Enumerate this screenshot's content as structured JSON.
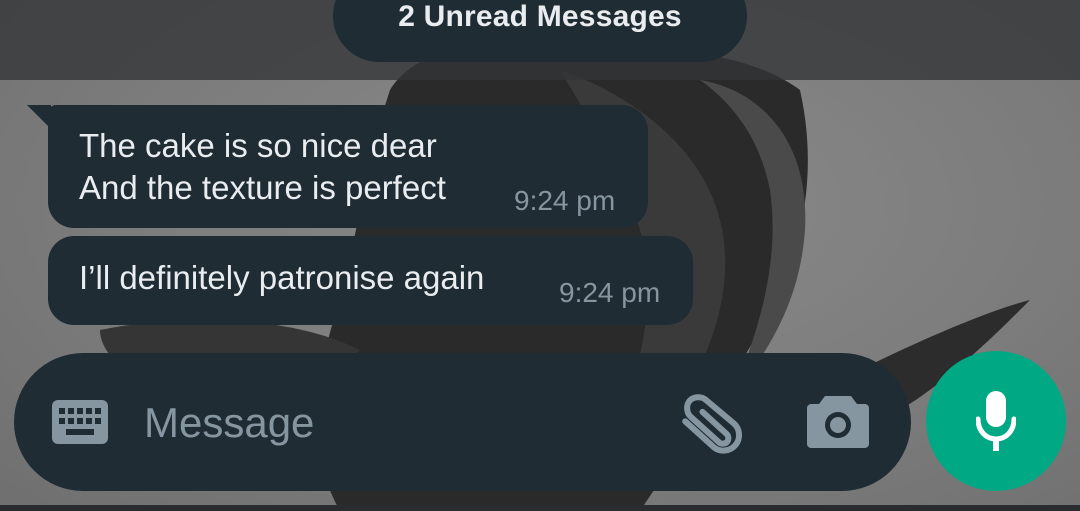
{
  "banner": {
    "unread_text": "2 Unread Messages"
  },
  "messages": [
    {
      "lines": "The cake is so nice dear\nAnd the texture is perfect",
      "time": "9:24 pm"
    },
    {
      "lines": "I’ll definitely patronise again",
      "time": "9:24 pm"
    }
  ],
  "composer": {
    "placeholder": "Message",
    "value": "",
    "icons": {
      "keyboard": "keyboard-icon",
      "attach": "paperclip-icon",
      "camera": "camera-icon",
      "mic": "microphone-icon"
    }
  },
  "colors": {
    "bubble": "#1f2c34",
    "text": "#e9edef",
    "meta": "#8696a0",
    "accent": "#00a884"
  }
}
